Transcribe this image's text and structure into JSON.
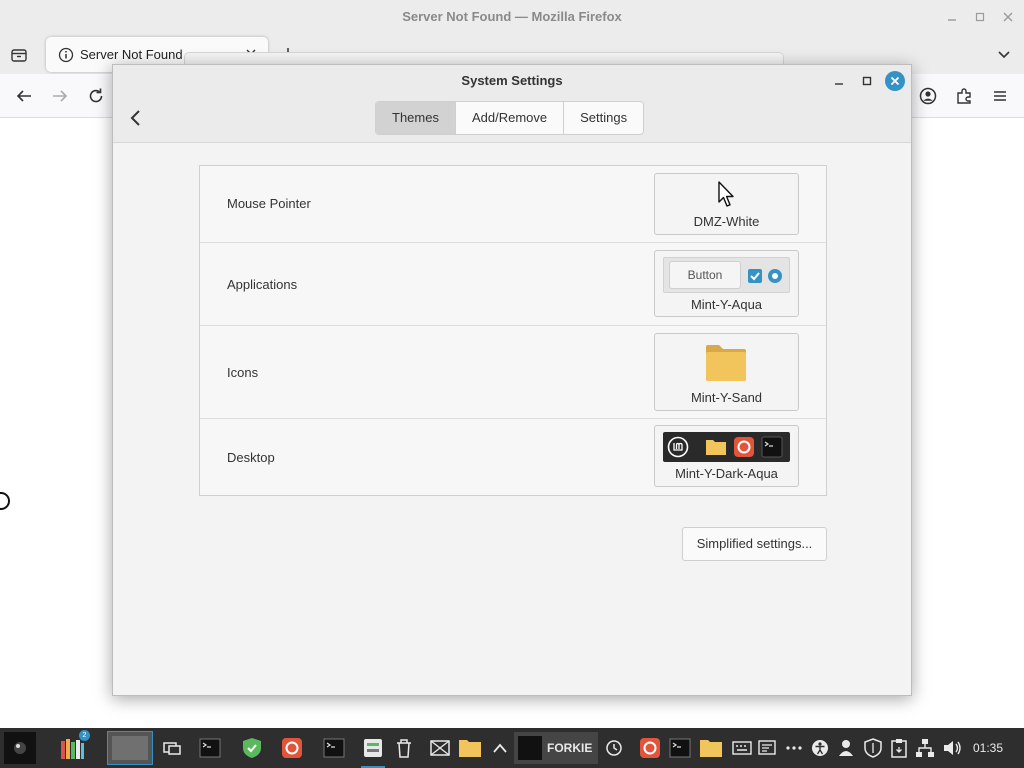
{
  "browser": {
    "window_title": "Server Not Found — Mozilla Firefox",
    "tab_title": "Server Not Found"
  },
  "dialog": {
    "title": "System Settings",
    "tabs": [
      {
        "label": "Themes",
        "active": true
      },
      {
        "label": "Add/Remove",
        "active": false
      },
      {
        "label": "Settings",
        "active": false
      }
    ],
    "rows": [
      {
        "label": "Mouse Pointer",
        "value": "DMZ-White",
        "preview": "pointer"
      },
      {
        "label": "Applications",
        "value": "Mint-Y-Aqua",
        "preview": "app",
        "preview_button": "Button"
      },
      {
        "label": "Icons",
        "value": "Mint-Y-Sand",
        "preview": "folder"
      },
      {
        "label": "Desktop",
        "value": "Mint-Y-Dark-Aqua",
        "preview": "desktop"
      }
    ],
    "simplified_button": "Simplified settings..."
  },
  "taskbar": {
    "forkie_label": "FORKIE",
    "clock": "01:35",
    "badge": "2"
  },
  "colors": {
    "accent": "#3592c4",
    "folder": "#f2c55c",
    "taskbar": "#2e2e2e"
  }
}
